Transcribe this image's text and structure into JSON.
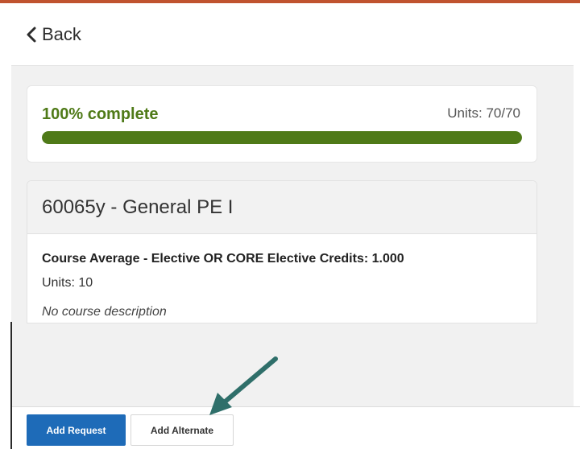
{
  "colors": {
    "accent": "#c0532f",
    "progress": "#4f7a18",
    "primary_button": "#1e6bb8",
    "arrow": "#2f6f6a"
  },
  "header": {
    "back_label": "Back",
    "back_icon": "chevron-left-icon"
  },
  "progress": {
    "label": "100% complete",
    "units_label": "Units: 70/70",
    "fraction": 1.0
  },
  "course": {
    "title": "60065y - General PE I",
    "average_line": "Course Average - Elective OR CORE Elective Credits: 1.000",
    "units_line": "Units: 10",
    "description": "No course description"
  },
  "footer": {
    "add_request_label": "Add Request",
    "add_alternate_label": "Add Alternate"
  },
  "annotation": {
    "icon": "arrow-annotation-icon"
  }
}
